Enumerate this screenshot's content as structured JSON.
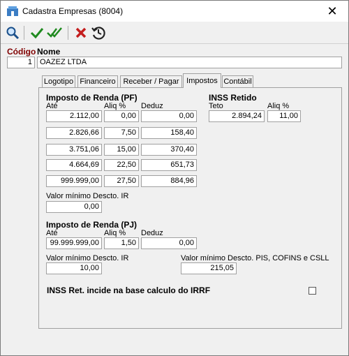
{
  "window": {
    "title": "Cadastra Empresas (8004)",
    "close_symbol": "✕"
  },
  "toolbar": {
    "icons": [
      "search-icon",
      "check-icon",
      "double-check-icon",
      "cancel-x-icon",
      "history-icon"
    ]
  },
  "header": {
    "codigo_label": "Código",
    "nome_label": "Nome",
    "codigo_value": "1",
    "nome_value": "OAZEZ LTDA"
  },
  "tabs": [
    {
      "label": "Logotipo"
    },
    {
      "label": "Financeiro"
    },
    {
      "label": "Receber / Pagar"
    },
    {
      "label": "Impostos"
    },
    {
      "label": "Contábil"
    }
  ],
  "active_tab": "Impostos",
  "ir_pf": {
    "title": "Imposto de Renda (PF)",
    "col_ate": "Até",
    "col_aliq": "Aliq %",
    "col_deduz": "Deduz",
    "rows": [
      {
        "ate": "2.112,00",
        "aliq": "0,00",
        "deduz": "0,00"
      },
      {
        "ate": "2.826,66",
        "aliq": "7,50",
        "deduz": "158,40"
      },
      {
        "ate": "3.751,06",
        "aliq": "15,00",
        "deduz": "370,40"
      },
      {
        "ate": "4.664,69",
        "aliq": "22,50",
        "deduz": "651,73"
      },
      {
        "ate": "999.999,00",
        "aliq": "27,50",
        "deduz": "884,96"
      }
    ],
    "min_label": "Valor mínimo Descto. IR",
    "min_value": "0,00"
  },
  "inss": {
    "title": "INSS Retido",
    "teto_label": "Teto",
    "aliq_label": "Aliq %",
    "teto_value": "2.894,24",
    "aliq_value": "11,00"
  },
  "ir_pj": {
    "title": "Imposto de Renda (PJ)",
    "col_ate": "Até",
    "col_aliq": "Aliq %",
    "col_deduz": "Deduz",
    "ate": "99.999.999,00",
    "aliq": "1,50",
    "deduz": "0,00",
    "min_ir_label": "Valor mínimo Descto. IR",
    "min_ir_value": "10,00",
    "min_pis_label": "Valor mínimo Descto. PIS, COFINS e CSLL",
    "min_pis_value": "215,05"
  },
  "inss_base": {
    "label": "INSS Ret. incide na base calculo do IRRF",
    "checked": false
  }
}
